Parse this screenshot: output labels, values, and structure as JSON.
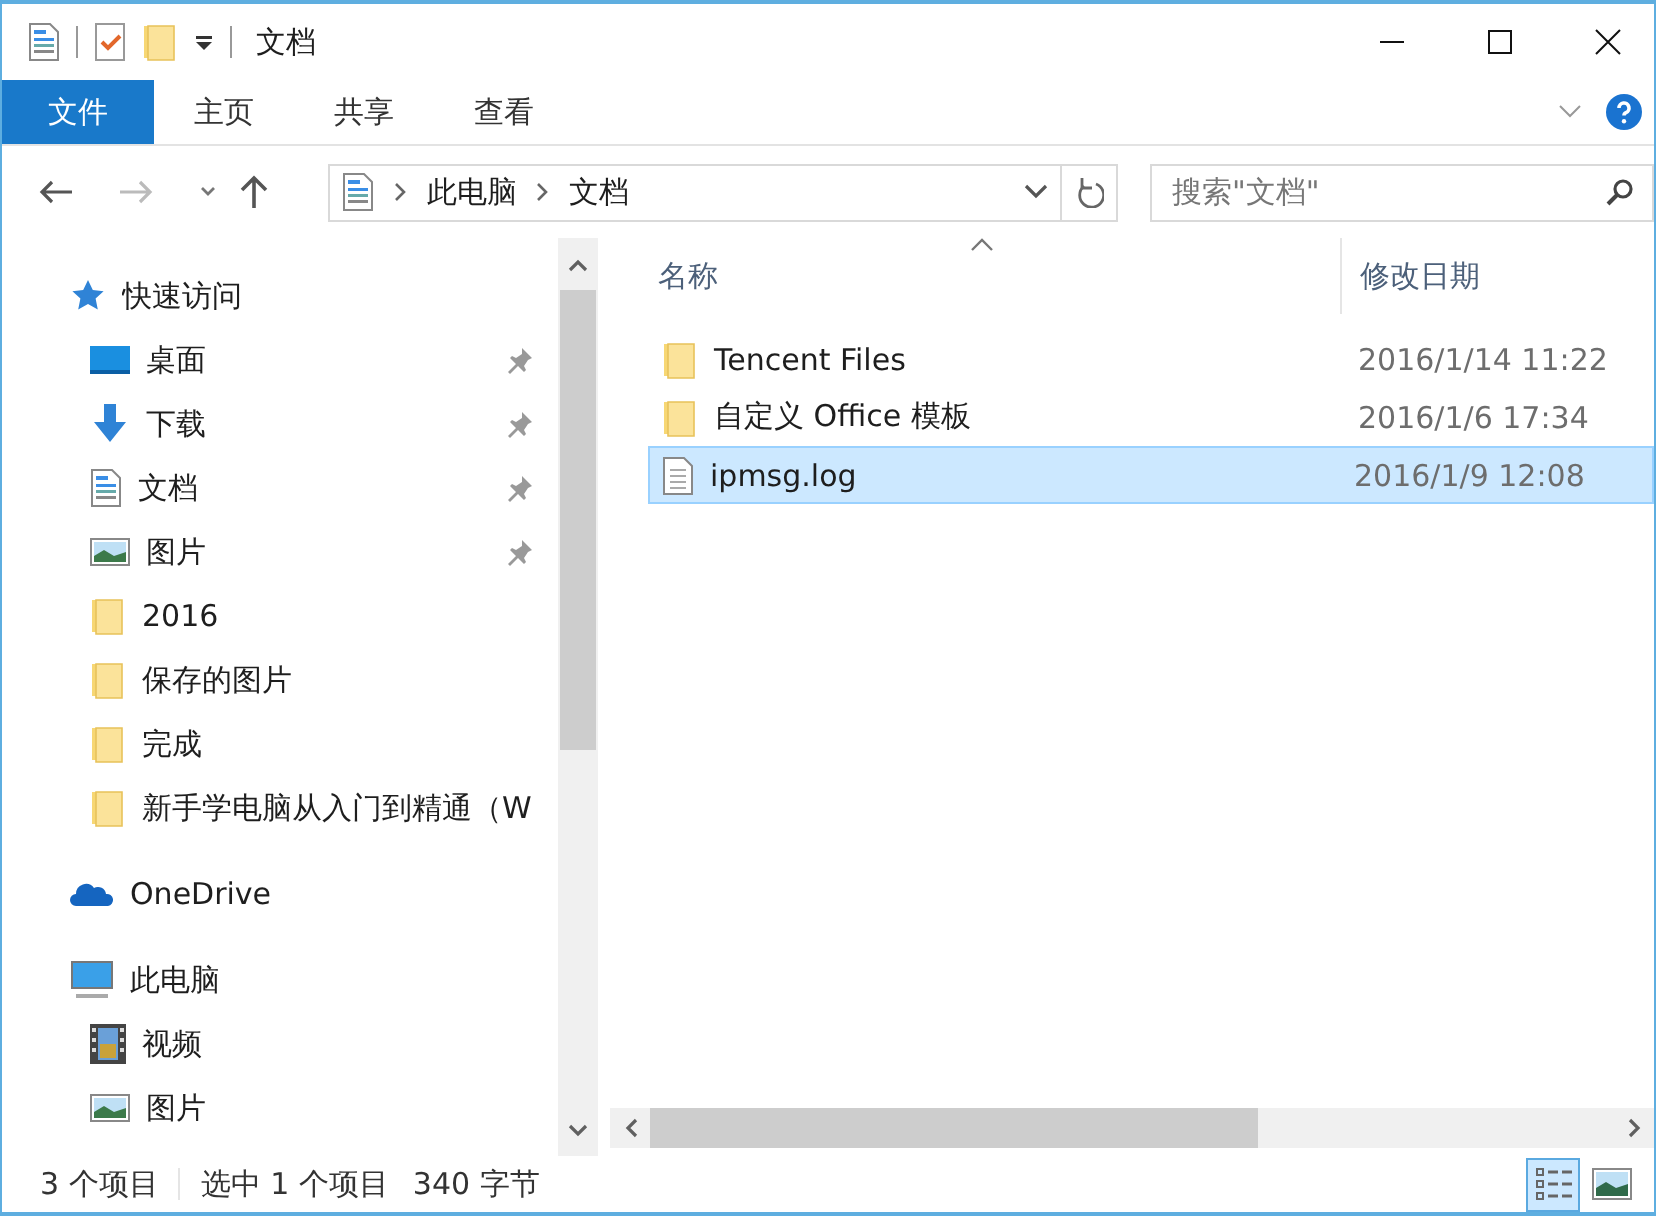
{
  "window": {
    "title": "文档"
  },
  "ribbon": {
    "tabs": [
      {
        "label": "文件",
        "kind": "file",
        "selected": false
      },
      {
        "label": "主页",
        "kind": "tab",
        "selected": false
      },
      {
        "label": "共享",
        "kind": "tab",
        "selected": false
      },
      {
        "label": "查看",
        "kind": "tab",
        "selected": false
      }
    ]
  },
  "address": {
    "crumbs": [
      "此电脑",
      "文档"
    ]
  },
  "search": {
    "placeholder": "搜索\"文档\""
  },
  "nav": [
    {
      "label": "快速访问",
      "kind": "star",
      "children": [
        {
          "label": "桌面",
          "kind": "desktop",
          "pinned": true
        },
        {
          "label": "下载",
          "kind": "download",
          "pinned": true
        },
        {
          "label": "文档",
          "kind": "document",
          "pinned": true
        },
        {
          "label": "图片",
          "kind": "pictures",
          "pinned": true
        },
        {
          "label": "2016",
          "kind": "folder",
          "pinned": false
        },
        {
          "label": "保存的图片",
          "kind": "folder",
          "pinned": false
        },
        {
          "label": "完成",
          "kind": "folder",
          "pinned": false
        },
        {
          "label": "新手学电脑从入门到精通（W",
          "kind": "folder",
          "pinned": false
        }
      ]
    },
    {
      "label": "OneDrive",
      "kind": "cloud"
    },
    {
      "label": "此电脑",
      "kind": "computer",
      "children": [
        {
          "label": "视频",
          "kind": "video",
          "pinned": false
        },
        {
          "label": "图片",
          "kind": "pictures",
          "pinned": false
        }
      ]
    }
  ],
  "table": {
    "columns": [
      "名称",
      "修改日期"
    ],
    "rows": [
      {
        "name": "Tencent Files",
        "kind": "folder",
        "date": "2016/1/14 11:22",
        "selected": false
      },
      {
        "name": "自定义 Office 模板",
        "kind": "folder",
        "date": "2016/1/6 17:34",
        "selected": false
      },
      {
        "name": "ipmsg.log",
        "kind": "file",
        "date": "2016/1/9 12:08",
        "selected": true
      }
    ]
  },
  "status_bar": {
    "items": [
      "3 个项目",
      "选中 1 个项目",
      "340 字节"
    ]
  },
  "views": [
    {
      "kind": "details",
      "selected": true
    },
    {
      "kind": "large-icons",
      "selected": false
    }
  ]
}
